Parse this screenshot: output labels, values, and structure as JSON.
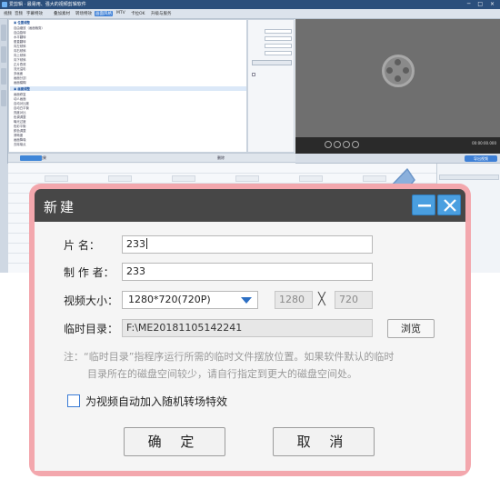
{
  "app": {
    "title": "爱剪辑 · 最易用、强大的视频剪辑软件",
    "menu": [
      "视频",
      "音频",
      "字幕特效",
      "叠加素材",
      "转场特效",
      "画面风格",
      "MTV",
      "卡拉OK",
      "升级与服务"
    ],
    "menu_active": "画面风格",
    "file_rows": [
      "位置调整",
      "自由缩放（画面裁剪）",
      "自由旋转",
      "水平翻转",
      "垂直翻转",
      "向左倾斜",
      "向右倾斜",
      "向上倾斜",
      "向下倾斜",
      "正片叠底",
      "流光溢彩",
      "多画面",
      "画面分割",
      "画面模糊"
    ],
    "file_rows_2": [
      "画面修复",
      "动人画面",
      "自动对比度",
      "自动白平衡",
      "亮度对比",
      "色调调整",
      "曝光过度",
      "色彩平衡",
      "颜色调整",
      "清晰度",
      "画面降噪",
      "去除噪点"
    ],
    "toolbar_add": "添加风格效果",
    "toolbar_delete": "删除",
    "export_label": "导出视频",
    "playtime": "00:00:00.000"
  },
  "dialog": {
    "title": "新建",
    "min_icon": "minimize-icon",
    "close_icon": "close-icon",
    "name_label": "片    名：",
    "name_value": "233",
    "author_label": "制 作 者：",
    "author_value": "233",
    "size_label": "视频大小：",
    "size_selected": "1280*720(720P)",
    "width_value": "1280",
    "height_value": "720",
    "times_symbol": "╳",
    "tempdir_label": "临时目录：",
    "tempdir_value": "F:\\ME20181105142241",
    "browse_label": "浏览",
    "note_line1": "注：“临时目录”指程序运行所需的临时文件摆放位置。如果软件默认的临时",
    "note_line2": "目录所在的磁盘空间较少，请自行指定到更大的磁盘空间处。",
    "checkbox_label": "为视频自动加入随机转场特效",
    "checkbox_checked": false,
    "ok_label": "确 定",
    "cancel_label": "取 消"
  },
  "colors": {
    "dialog_border": "#f3a7ad",
    "title_bar": "#474747",
    "title_button": "#4a9fe0",
    "arrow": "#8bb0dc"
  }
}
